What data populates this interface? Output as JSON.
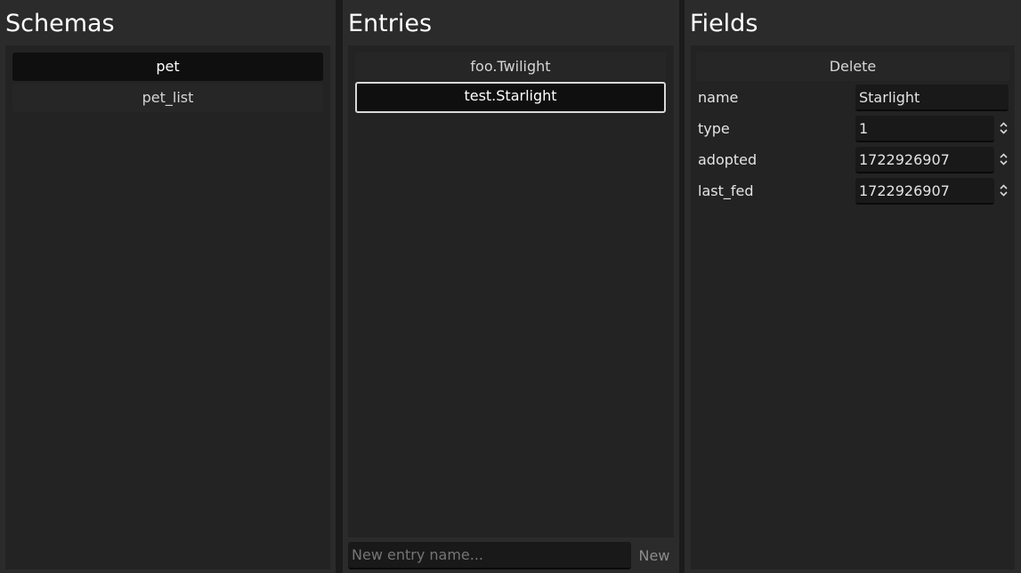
{
  "schemas": {
    "title": "Schemas",
    "items": [
      {
        "label": "pet",
        "state": "selected"
      },
      {
        "label": "pet_list",
        "state": "normal"
      }
    ]
  },
  "entries": {
    "title": "Entries",
    "items": [
      {
        "label": "foo.Twilight",
        "state": "normal"
      },
      {
        "label": "test.Starlight",
        "state": "focused"
      }
    ],
    "new_entry_placeholder": "New entry name...",
    "new_button_label": "New"
  },
  "fields": {
    "title": "Fields",
    "delete_label": "Delete",
    "rows": [
      {
        "label": "name",
        "value": "Starlight",
        "spinner": false
      },
      {
        "label": "type",
        "value": "1",
        "spinner": true
      },
      {
        "label": "adopted",
        "value": "1722926907",
        "spinner": true
      },
      {
        "label": "last_fed",
        "value": "1722926907",
        "spinner": true
      }
    ]
  },
  "icons": {
    "spinner": "up-down-arrows-icon"
  },
  "colors": {
    "background": "#1b1b1b",
    "panel": "#2b2b2b",
    "panel_body": "#232323",
    "selected_item": "#0f0f0f",
    "focus_border": "#d8d8d8"
  }
}
